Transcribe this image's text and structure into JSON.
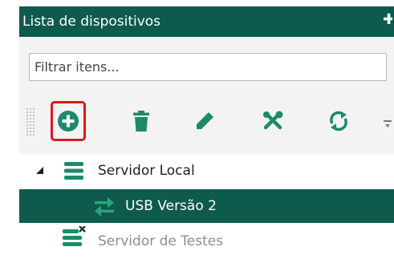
{
  "header": {
    "title": "Lista de dispositivos",
    "pin_icon": "pin-icon"
  },
  "filter": {
    "placeholder": "Filtrar itens...",
    "value": ""
  },
  "toolbar": {
    "buttons": [
      {
        "id": "add",
        "icon": "add-circle-icon",
        "highlighted": true
      },
      {
        "id": "delete",
        "icon": "trash-icon"
      },
      {
        "id": "edit",
        "icon": "pencil-icon"
      },
      {
        "id": "tools",
        "icon": "tools-icon"
      },
      {
        "id": "sync",
        "icon": "sync-icon"
      }
    ],
    "overflow_icon": "overflow-chevron-icon"
  },
  "tree": {
    "items": [
      {
        "label": "Servidor Local",
        "icon": "server-icon",
        "expanded": true,
        "selected": false,
        "enabled": true
      },
      {
        "label": "USB Versão 2",
        "icon": "usb-transfer-icon",
        "selected": true,
        "enabled": true
      },
      {
        "label": "Servidor de Testes",
        "icon": "server-disconnected-icon",
        "selected": false,
        "enabled": false
      }
    ]
  },
  "colors": {
    "header_bg": "#0e5a4c",
    "accent_green": "#1d8a6a",
    "selection_bg": "#0e5a4c",
    "highlight_border": "#e0161d",
    "toolbar_bg": "#f3f3f3"
  }
}
